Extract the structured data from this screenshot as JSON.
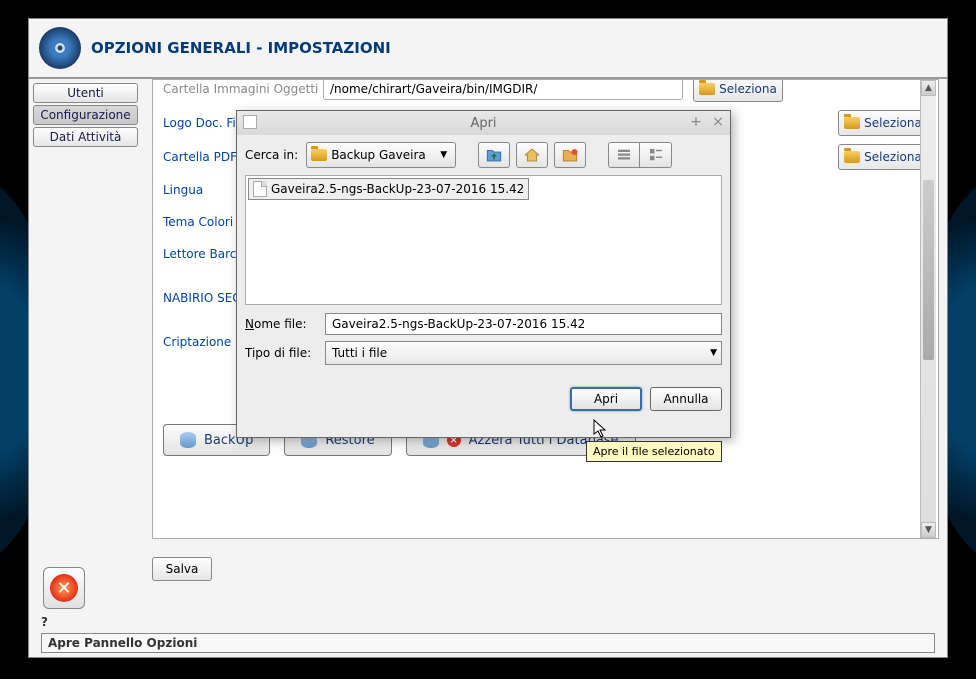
{
  "header": {
    "title": "OPZIONI GENERALI - IMPOSTAZIONI"
  },
  "sidebar": {
    "items": [
      {
        "label": "Utenti"
      },
      {
        "label": "Configurazione"
      },
      {
        "label": "Dati Attività"
      }
    ],
    "active_index": 1
  },
  "form": {
    "rows": [
      {
        "label": "Cartella Immagini Oggetti",
        "value": "/nome/chirart/Gaveira/bin/IMGDIR/"
      },
      {
        "label": "Logo Doc. Fis"
      },
      {
        "label": "Cartella PDF"
      },
      {
        "label": "Lingua"
      },
      {
        "label": "Tema Colori"
      },
      {
        "label": "Lettore Barco"
      },
      {
        "label": "NABIRIO SECU"
      },
      {
        "label": "Criptazione D"
      }
    ],
    "seleziona_label": "Seleziona"
  },
  "buttons": {
    "backup": "BackUp",
    "restore": "Restore",
    "azzera": "Azzera Tutti i Database",
    "salva": "Salva"
  },
  "statusbar": {
    "text": "Apre Pannello Opzioni",
    "help": "?"
  },
  "dialog": {
    "title": "Apri",
    "search_label": "Cerca in:",
    "folder_name": "Backup Gaveira",
    "file_items": [
      {
        "name": "Gaveira2.5-ngs-BackUp-23-07-2016 15.42"
      }
    ],
    "filename_label": "Nome file:",
    "filename_value": "Gaveira2.5-ngs-BackUp-23-07-2016 15.42",
    "filetype_label": "Tipo di file:",
    "filetype_value": "Tutti i file",
    "open": "Apri",
    "cancel": "Annulla",
    "tooltip": "Apre il file selezionato",
    "toolbar_icons": [
      "up-folder",
      "home",
      "new-folder",
      "list-view",
      "detail-view"
    ]
  }
}
